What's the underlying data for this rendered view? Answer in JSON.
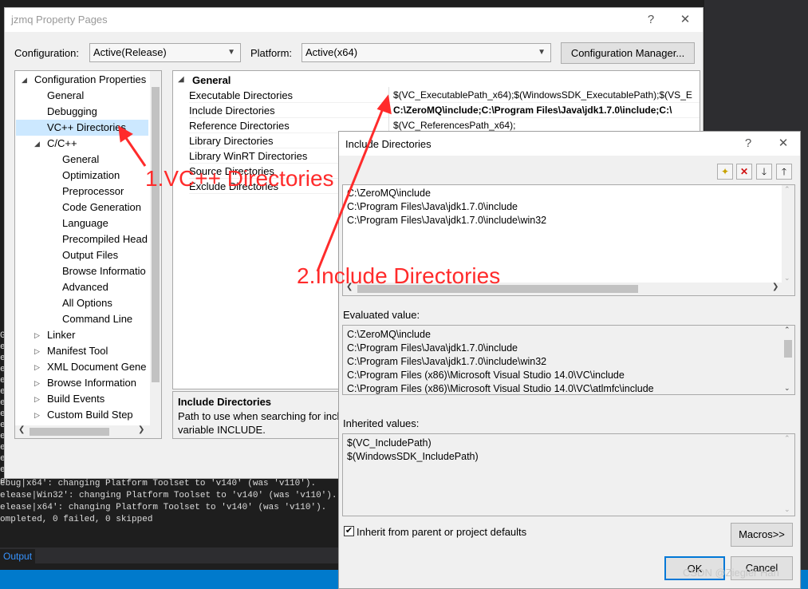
{
  "ide": {
    "output_lines": [
      "ebug|x64': changing Platform Toolset to 'v140' (was 'v110').",
      "elease|Win32': changing Platform Toolset to 'v140' (was 'v110').",
      "elease|x64': changing Platform Toolset to 'v140' (was 'v110').",
      "ompleted, 0 failed, 0 skipped"
    ],
    "output_tab": "Output",
    "left_edge_chars": [
      "G",
      "e",
      "e",
      "e",
      "e",
      "e",
      "e",
      "e",
      "e",
      "e",
      "e",
      "e",
      "e",
      "e"
    ]
  },
  "property_pages": {
    "title": "jzmq Property Pages",
    "help_button": "?",
    "close_button": "✕",
    "configuration_label": "Configuration:",
    "configuration_value": "Active(Release)",
    "platform_label": "Platform:",
    "platform_value": "Active(x64)",
    "config_manager_button": "Configuration Manager...",
    "tree": [
      {
        "label": "Configuration Properties",
        "level": 0,
        "toggle": "◢"
      },
      {
        "label": "General",
        "level": 1
      },
      {
        "label": "Debugging",
        "level": 1
      },
      {
        "label": "VC++ Directories",
        "level": 1,
        "selected": true
      },
      {
        "label": "C/C++",
        "level": 1,
        "toggle": "◢"
      },
      {
        "label": "General",
        "level": 2
      },
      {
        "label": "Optimization",
        "level": 2
      },
      {
        "label": "Preprocessor",
        "level": 2
      },
      {
        "label": "Code Generation",
        "level": 2
      },
      {
        "label": "Language",
        "level": 2
      },
      {
        "label": "Precompiled Head",
        "level": 2
      },
      {
        "label": "Output Files",
        "level": 2
      },
      {
        "label": "Browse Informatio",
        "level": 2
      },
      {
        "label": "Advanced",
        "level": 2
      },
      {
        "label": "All Options",
        "level": 2
      },
      {
        "label": "Command Line",
        "level": 2
      },
      {
        "label": "Linker",
        "level": 1,
        "toggle": "▷"
      },
      {
        "label": "Manifest Tool",
        "level": 1,
        "toggle": "▷"
      },
      {
        "label": "XML Document Gene",
        "level": 1,
        "toggle": "▷"
      },
      {
        "label": "Browse Information",
        "level": 1,
        "toggle": "▷"
      },
      {
        "label": "Build Events",
        "level": 1,
        "toggle": "▷"
      },
      {
        "label": "Custom Build Step",
        "level": 1,
        "toggle": "▷"
      }
    ],
    "grid": {
      "category": "General",
      "rows": [
        {
          "name": "Executable Directories",
          "value": "$(VC_ExecutablePath_x64);$(WindowsSDK_ExecutablePath);$(VS_E"
        },
        {
          "name": "Include Directories",
          "value": "C:\\ZeroMQ\\include;C:\\Program Files\\Java\\jdk1.7.0\\include;C:\\",
          "bold": true
        },
        {
          "name": "Reference Directories",
          "value": "$(VC_ReferencesPath_x64);"
        },
        {
          "name": "Library Directories",
          "value": ""
        },
        {
          "name": "Library WinRT Directories",
          "value": ""
        },
        {
          "name": "Source Directories",
          "value": ""
        },
        {
          "name": "Exclude Directories",
          "value": ""
        }
      ]
    },
    "description": {
      "title": "Include Directories",
      "text_line1": "Path to use when searching for incl",
      "text_line2": "variable INCLUDE."
    }
  },
  "include_dialog": {
    "title": "Include Directories",
    "help_button": "?",
    "close_button": "✕",
    "toolbar_icons": [
      "new-line-icon",
      "delete-icon",
      "move-down-icon",
      "move-up-icon"
    ],
    "entries": [
      "C:\\ZeroMQ\\include",
      "C:\\Program Files\\Java\\jdk1.7.0\\include",
      "C:\\Program Files\\Java\\jdk1.7.0\\include\\win32"
    ],
    "evaluated_label": "Evaluated value:",
    "evaluated": [
      "C:\\ZeroMQ\\include",
      "C:\\Program Files\\Java\\jdk1.7.0\\include",
      "C:\\Program Files\\Java\\jdk1.7.0\\include\\win32",
      "C:\\Program Files (x86)\\Microsoft Visual Studio 14.0\\VC\\include",
      "C:\\Program Files (x86)\\Microsoft Visual Studio 14.0\\VC\\atlmfc\\include"
    ],
    "inherited_label": "Inherited values:",
    "inherited": [
      "$(VC_IncludePath)",
      "$(WindowsSDK_IncludePath)"
    ],
    "inherit_checkbox_label": "Inherit from parent or project defaults",
    "inherit_checked": true,
    "macros_button": "Macros>>",
    "ok_button": "OK",
    "cancel_button": "Cancel"
  },
  "annotations": {
    "step1": "1.VC++ Directories",
    "step2": "2.Include Directories",
    "color": "#ff2b2b"
  },
  "watermark": "CSDN @Ziegler Han"
}
